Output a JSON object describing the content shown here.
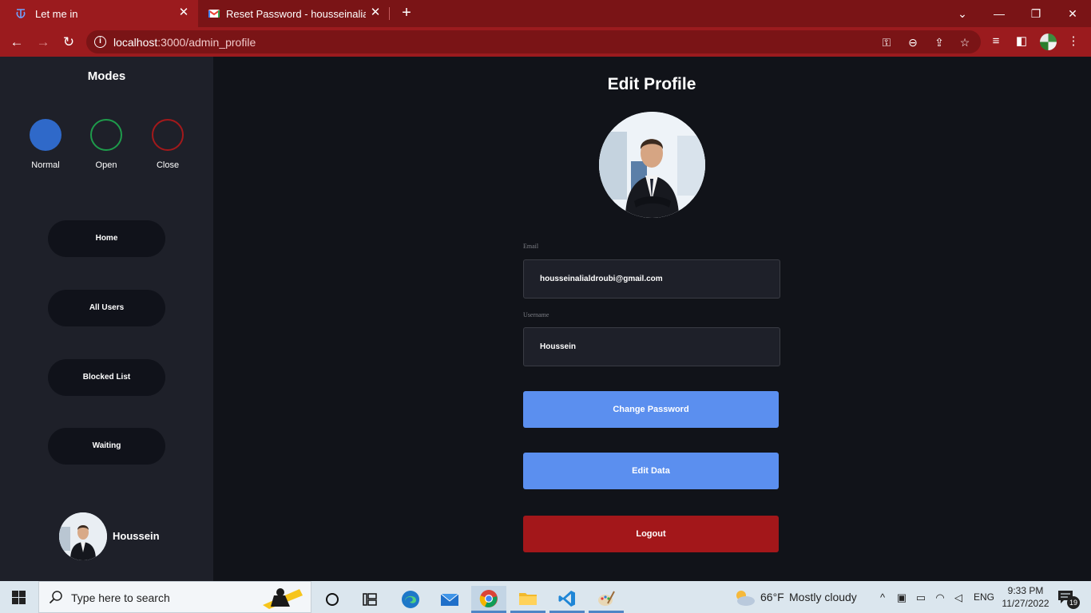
{
  "browser": {
    "tabs": [
      {
        "title": "Let me in",
        "active": true
      },
      {
        "title": "Reset Password - housseinalialdroubi",
        "active": false
      }
    ],
    "address": {
      "host": "localhost",
      "port_path": ":3000/admin_profile"
    },
    "theme_color": "#9b1b1e"
  },
  "sidebar": {
    "modes_title": "Modes",
    "modes": [
      {
        "label": "Normal",
        "color": "#2f69c9"
      },
      {
        "label": "Open",
        "color": "#1e9b4b"
      },
      {
        "label": "Close",
        "color": "#a3191b"
      }
    ],
    "nav": [
      "Home",
      "All Users",
      "Blocked List",
      "Waiting"
    ],
    "user_name": "Houssein"
  },
  "main": {
    "title": "Edit Profile",
    "email_label": "Email",
    "email_value": "housseinalialdroubi@gmail.com",
    "username_label": "Username",
    "username_value": "Houssein",
    "change_password": "Change Password",
    "edit_data": "Edit Data",
    "logout": "Logout"
  },
  "taskbar": {
    "search_placeholder": "Type here to search",
    "weather_temp": "66°F",
    "weather_desc": "Mostly cloudy",
    "language": "ENG",
    "time": "9:33 PM",
    "date": "11/27/2022",
    "notifications": "19"
  }
}
